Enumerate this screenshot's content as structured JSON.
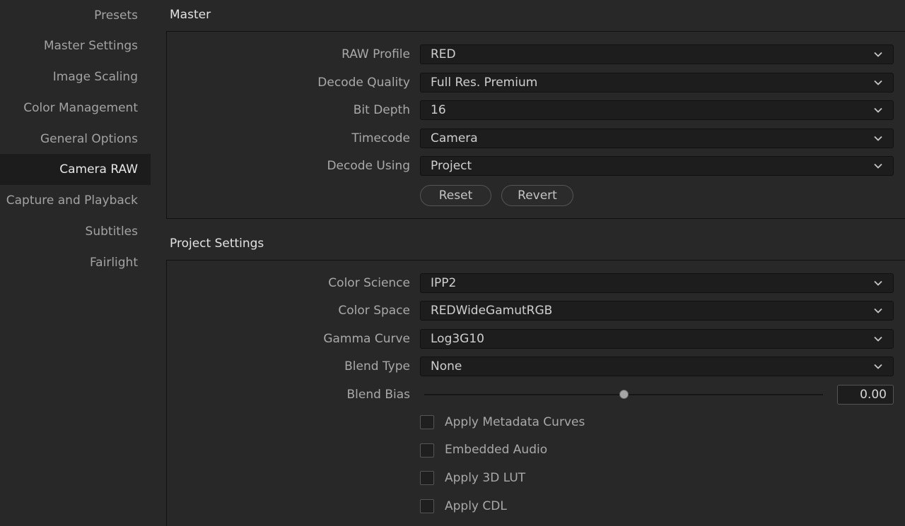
{
  "sidebar": {
    "items": [
      {
        "label": "Presets"
      },
      {
        "label": "Master Settings"
      },
      {
        "label": "Image Scaling"
      },
      {
        "label": "Color Management"
      },
      {
        "label": "General Options"
      },
      {
        "label": "Camera RAW",
        "active": true
      },
      {
        "label": "Capture and Playback"
      },
      {
        "label": "Subtitles"
      },
      {
        "label": "Fairlight"
      }
    ]
  },
  "master": {
    "title": "Master",
    "fields": [
      {
        "label": "RAW Profile",
        "value": "RED"
      },
      {
        "label": "Decode Quality",
        "value": "Full Res. Premium"
      },
      {
        "label": "Bit Depth",
        "value": "16"
      },
      {
        "label": "Timecode",
        "value": "Camera"
      },
      {
        "label": "Decode Using",
        "value": "Project"
      }
    ],
    "reset_label": "Reset",
    "revert_label": "Revert"
  },
  "project": {
    "title": "Project Settings",
    "fields": [
      {
        "label": "Color Science",
        "value": "IPP2"
      },
      {
        "label": "Color Space",
        "value": "REDWideGamutRGB"
      },
      {
        "label": "Gamma Curve",
        "value": "Log3G10"
      },
      {
        "label": "Blend Type",
        "value": "None"
      }
    ],
    "blend_bias": {
      "label": "Blend Bias",
      "value": "0.00"
    },
    "checkboxes": [
      {
        "label": "Apply Metadata Curves",
        "checked": false
      },
      {
        "label": "Embedded Audio",
        "checked": false
      },
      {
        "label": "Apply 3D LUT",
        "checked": false
      },
      {
        "label": "Apply CDL",
        "checked": false
      }
    ]
  },
  "icons": {
    "dropdown": "chevron-down-icon"
  },
  "colors": {
    "background": "#282828",
    "sidebar_active": "#1c1c1c",
    "field_bg": "#1d1d1d"
  }
}
